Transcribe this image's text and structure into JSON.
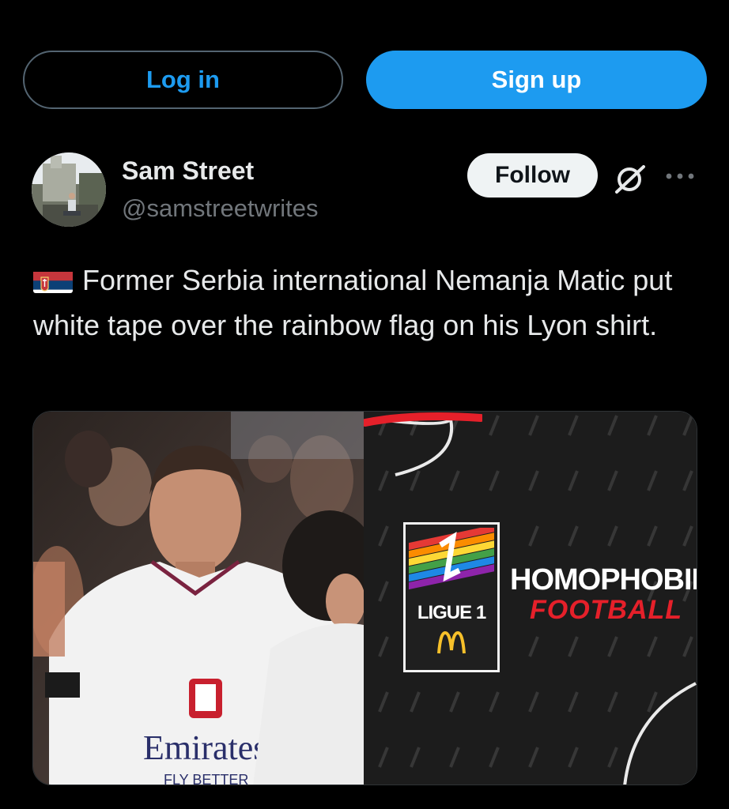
{
  "auth": {
    "login_label": "Log in",
    "signup_label": "Sign up"
  },
  "author": {
    "name": "Sam Street",
    "handle": "@samstreetwrites",
    "follow_label": "Follow"
  },
  "tweet": {
    "flag_emoji": "serbia-flag",
    "text": "Former Serbia international Nemanja Matic put white tape over the rainbow flag on his Lyon shirt."
  },
  "media": {
    "photo_description_icon": "player-photo",
    "graphic": {
      "ligue_text": "LIGUE 1",
      "headline": "HOMOPHOBIE",
      "subline": "FOOTBALL"
    },
    "shirt_sponsor": "Emirates",
    "shirt_sponsor_sub": "FLY BETTER"
  },
  "colors": {
    "background": "#000000",
    "accent": "#1d9bf0",
    "muted_text": "#71767b",
    "follow_bg": "#eff3f4"
  }
}
